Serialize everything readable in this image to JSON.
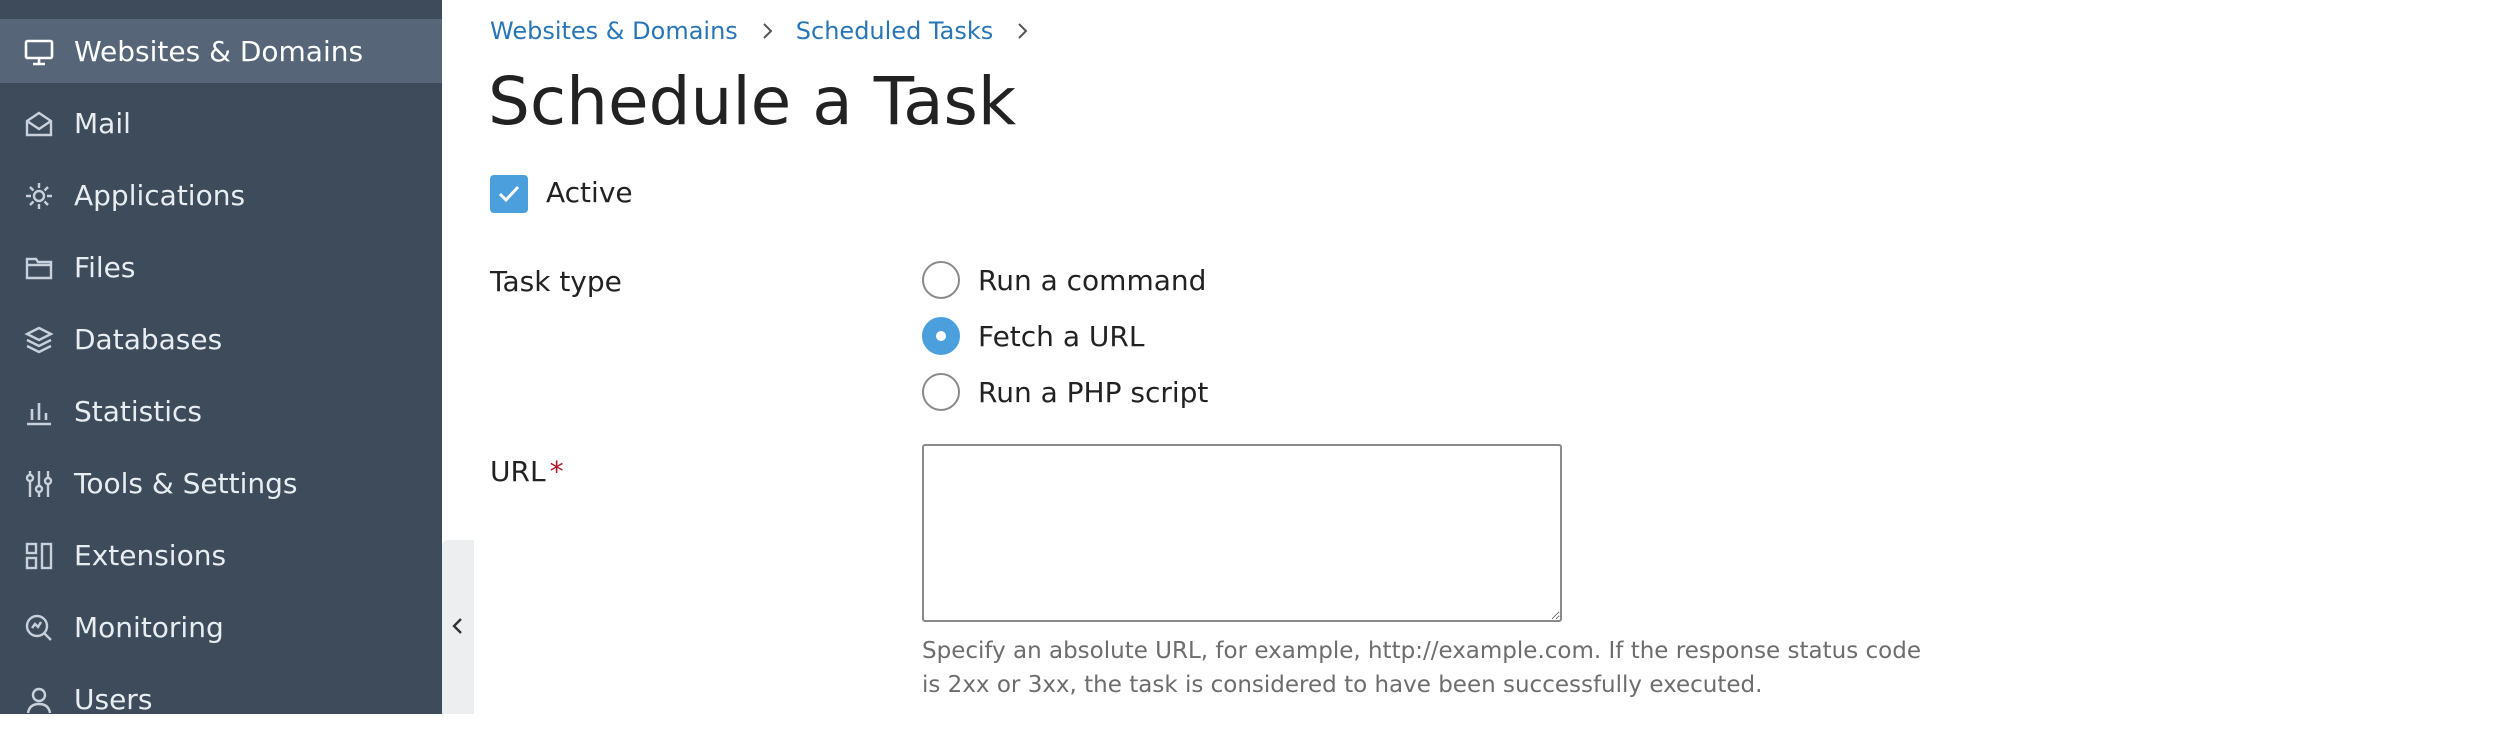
{
  "sidebar": {
    "items": [
      {
        "label": "Websites & Domains",
        "icon": "monitor-icon",
        "active": true
      },
      {
        "label": "Mail",
        "icon": "mail-icon"
      },
      {
        "label": "Applications",
        "icon": "gear-icon"
      },
      {
        "label": "Files",
        "icon": "folder-icon"
      },
      {
        "label": "Databases",
        "icon": "layers-icon"
      },
      {
        "label": "Statistics",
        "icon": "bar-chart-icon"
      },
      {
        "label": "Tools & Settings",
        "icon": "sliders-icon"
      },
      {
        "label": "Extensions",
        "icon": "extensions-icon"
      },
      {
        "label": "Monitoring",
        "icon": "monitoring-icon"
      },
      {
        "label": "Users",
        "icon": "user-icon"
      }
    ]
  },
  "breadcrumb": {
    "items": [
      "Websites & Domains",
      "Scheduled Tasks"
    ]
  },
  "page": {
    "title": "Schedule a Task"
  },
  "form": {
    "active": {
      "label": "Active",
      "checked": true
    },
    "task_type": {
      "label": "Task type",
      "options": [
        "Run a command",
        "Fetch a URL",
        "Run a PHP script"
      ],
      "selected": "Fetch a URL"
    },
    "url": {
      "label": "URL",
      "required_mark": "*",
      "value": "",
      "hint": "Specify an absolute URL, for example, http://example.com. If the response status code is 2xx or 3xx, the task is considered to have been successfully executed."
    }
  },
  "colors": {
    "sidebar_bg": "#3d4b5b",
    "sidebar_active": "#566678",
    "link": "#2876b6",
    "accent": "#4b9fdc",
    "required": "#b2182b"
  }
}
